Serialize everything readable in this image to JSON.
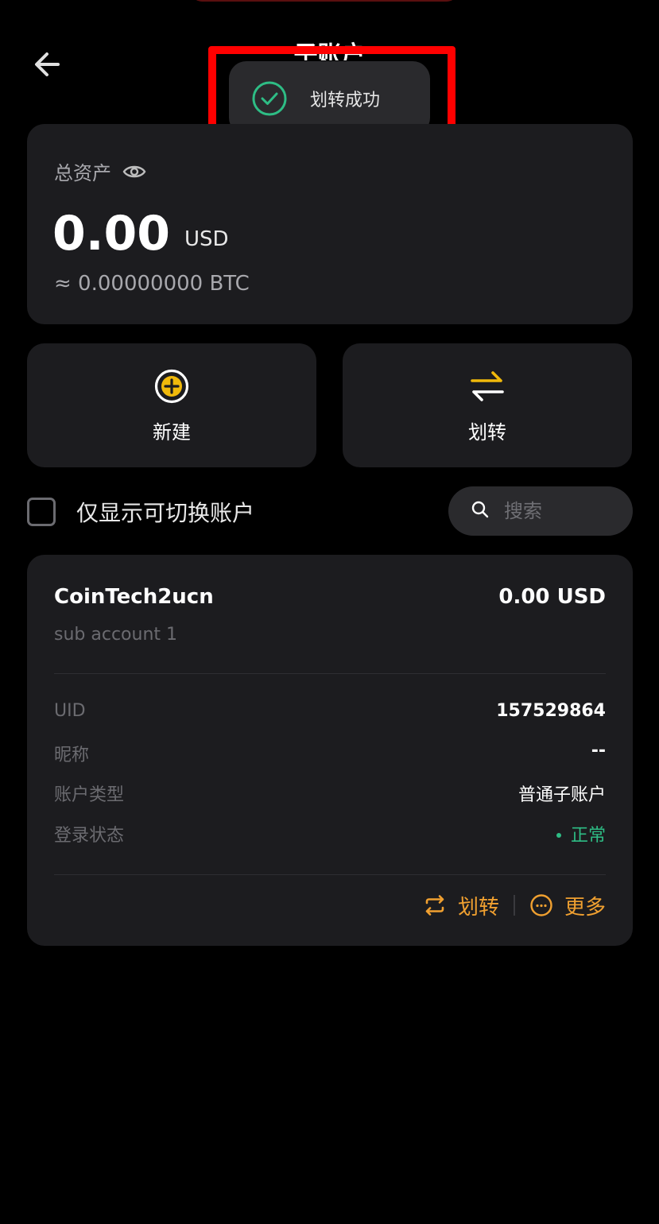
{
  "header": {
    "title": "子账户",
    "back_icon": "arrow-left-icon"
  },
  "toast": {
    "message": "划转成功",
    "icon": "check-circle-icon",
    "color": "#2ebd85"
  },
  "assets": {
    "label": "总资产",
    "eye_icon": "eye-icon",
    "value": "0.00",
    "unit": "USD",
    "btc_equivalent": "≈ 0.00000000 BTC"
  },
  "actions": {
    "create_label": "新建",
    "transfer_label": "划转",
    "accent": "#f0b90b"
  },
  "filter": {
    "label": "仅显示可切换账户",
    "checked": false
  },
  "search": {
    "placeholder": "搜索",
    "value": ""
  },
  "account": {
    "name": "CoinTech2ucn",
    "balance": "0.00 USD",
    "remark": "sub account 1",
    "rows": [
      {
        "key": "UID",
        "value": "157529864"
      },
      {
        "key": "昵称",
        "value": "--"
      },
      {
        "key": "账户类型",
        "value": "普通子账户"
      },
      {
        "key": "登录状态",
        "value": "正常"
      }
    ],
    "transfer_label": "划转",
    "more_label": "更多",
    "status_color": "#2ebd85",
    "action_color": "#f0a030"
  }
}
